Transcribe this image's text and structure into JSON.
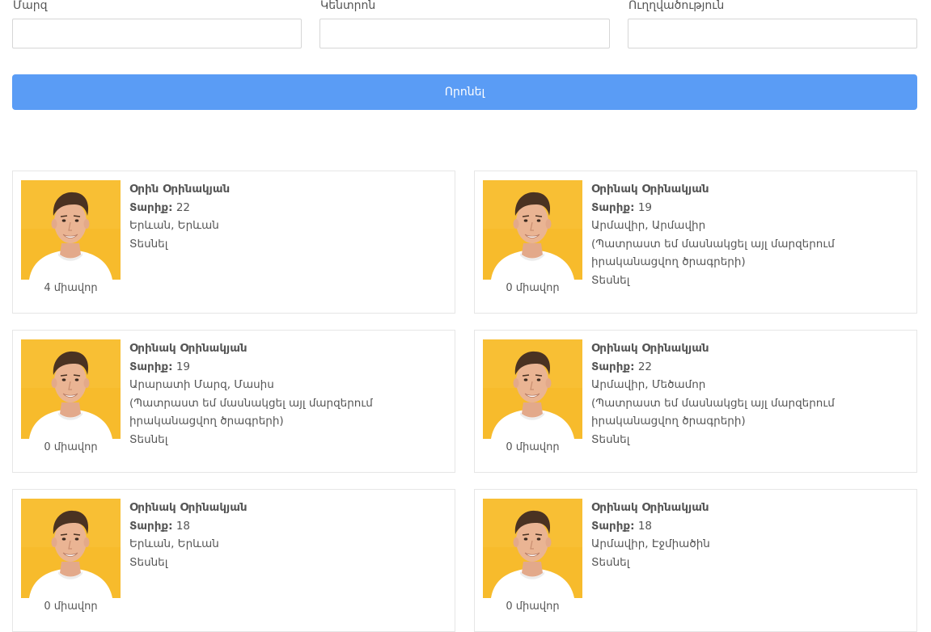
{
  "filters": {
    "region_label": "Մարզ",
    "center_label": "Կենտրոն",
    "direction_label": "Ուղղվածություն",
    "region_value": "",
    "center_value": "",
    "direction_value": ""
  },
  "search_button": "Որոնել",
  "age_label": "Տարիք:",
  "view_label": "Տեսնել",
  "cards": [
    {
      "name": "Օրին Օրինակյան",
      "age": "22",
      "location": "Երևան, Երևան",
      "note": "",
      "points": "4 միավոր"
    },
    {
      "name": "Օրինակ Օրինակյան",
      "age": "19",
      "location": "Արմավիր, Արմավիր",
      "note": "(Պատրաստ եմ մասնակցել այլ մարզերում իրականացվող ծրագրերի)",
      "points": "0 միավոր"
    },
    {
      "name": "Օրինակ Օրինակյան",
      "age": "19",
      "location": "Արարատի Մարզ, Մասիս",
      "note": "(Պատրաստ եմ մասնակցել այլ մարզերում իրականացվող ծրագրերի)",
      "points": "0 միավոր"
    },
    {
      "name": "Օրինակ Օրինակյան",
      "age": "22",
      "location": "Արմավիր, Մեծամոր",
      "note": "(Պատրաստ եմ մասնակցել այլ մարզերում իրականացվող ծրագրերի)",
      "points": "0 միավոր"
    },
    {
      "name": "Օրինակ Օրինակյան",
      "age": "18",
      "location": "Երևան, Երևան",
      "note": "",
      "points": "0 միավոր"
    },
    {
      "name": "Օրինակ Օրինակյան",
      "age": "18",
      "location": "Արմավիր, Էջմիածին",
      "note": "",
      "points": "0 միավոր"
    }
  ]
}
